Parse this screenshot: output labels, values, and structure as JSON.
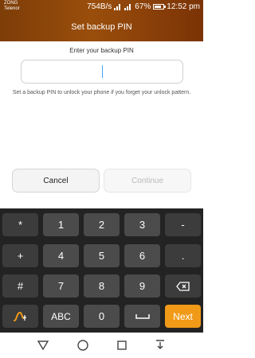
{
  "status": {
    "carrier_1": "ZONG",
    "carrier_2": "Telenor",
    "net_speed": "754B/s",
    "battery": "67%",
    "time": "12:52 pm"
  },
  "header": {
    "title": "Set backup PIN"
  },
  "form": {
    "prompt": "Enter your backup PIN",
    "pin_value": "",
    "help_text": "Set a backup PIN to unlock your phone if you forget your unlock pattern.",
    "cancel_label": "Cancel",
    "continue_label": "Continue"
  },
  "keyboard": {
    "row1": [
      "*",
      "1",
      "2",
      "3",
      "-"
    ],
    "row2": [
      "+",
      "4",
      "5",
      "6",
      "."
    ],
    "row3": [
      "#",
      "7",
      "8",
      "9"
    ],
    "row4": [
      "ABC",
      "0",
      "Next"
    ]
  },
  "colors": {
    "accent": "#f19a17",
    "header": "#8a450a"
  },
  "icons": [
    "signal-icon",
    "battery-icon",
    "backspace-icon",
    "space-icon",
    "swype-icon",
    "back-icon",
    "home-icon",
    "recents-icon",
    "notification-icon"
  ]
}
